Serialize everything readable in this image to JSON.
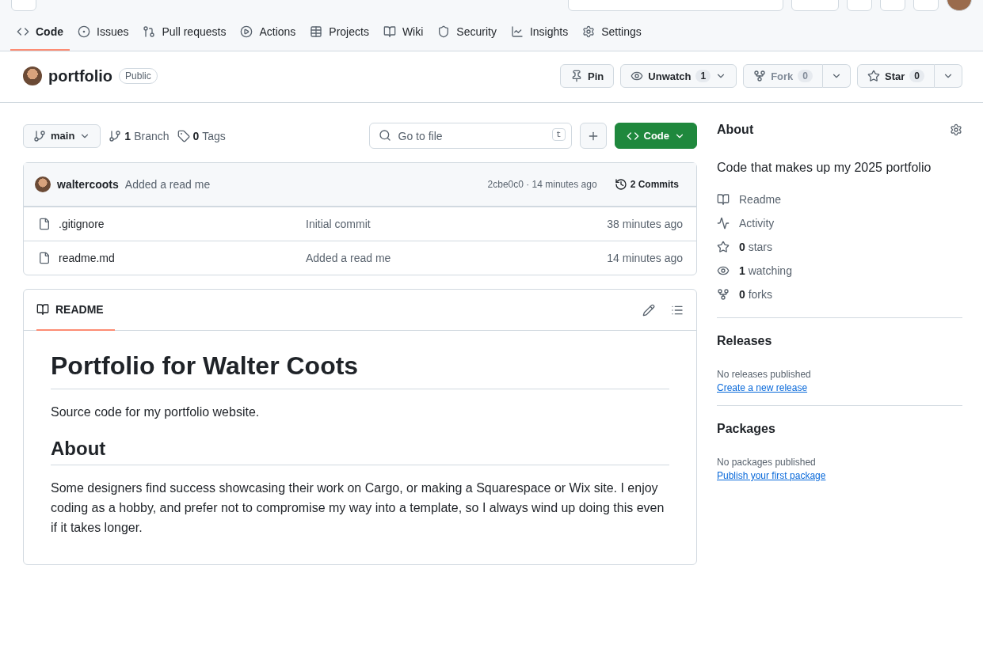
{
  "repo_nav": [
    {
      "label": "Code",
      "selected": true
    },
    {
      "label": "Issues",
      "selected": false
    },
    {
      "label": "Pull requests",
      "selected": false
    },
    {
      "label": "Actions",
      "selected": false
    },
    {
      "label": "Projects",
      "selected": false
    },
    {
      "label": "Wiki",
      "selected": false
    },
    {
      "label": "Security",
      "selected": false
    },
    {
      "label": "Insights",
      "selected": false
    },
    {
      "label": "Settings",
      "selected": false
    }
  ],
  "repo": {
    "name": "portfolio",
    "visibility": "Public"
  },
  "repo_actions": {
    "pin": "Pin",
    "watch": {
      "label": "Unwatch",
      "count": "1"
    },
    "fork": {
      "label": "Fork",
      "count": "0",
      "disabled": true
    },
    "star": {
      "label": "Star",
      "count": "0"
    }
  },
  "branch": {
    "name": "main",
    "branches": "1",
    "branches_label": "Branch",
    "tags": "0",
    "tags_label": "Tags"
  },
  "go_to_file": {
    "placeholder": "Go to file",
    "shortcut": "t"
  },
  "code_button": "Code",
  "latest_commit": {
    "author": "waltercoots",
    "message": "Added a read me",
    "hash_time": "2cbe0c0 · 14 minutes ago",
    "commits": "2 Commits"
  },
  "files": [
    {
      "name": ".gitignore",
      "commit": "Initial commit",
      "time": "38 minutes ago"
    },
    {
      "name": "readme.md",
      "commit": "Added a read me",
      "time": "14 minutes ago"
    }
  ],
  "readme": {
    "tab": "README",
    "title": "Portfolio for Walter Coots",
    "blocks": [
      {
        "kind": "p",
        "text": "Source code for my portfolio website."
      },
      {
        "kind": "h2",
        "text": "About"
      },
      {
        "kind": "p",
        "text": "Some designers find success showcasing their work on Cargo, or making a Squarespace or Wix site. I enjoy coding as a hobby, and prefer not to compromise my way into a template, so I always wind up doing this even if it takes longer."
      }
    ]
  },
  "about": {
    "title": "About",
    "description": "Code that makes up my 2025 portfolio",
    "items": [
      {
        "label": "Readme"
      },
      {
        "label": "Activity"
      },
      {
        "count": "0",
        "label": "stars"
      },
      {
        "count": "1",
        "label": "watching"
      },
      {
        "count": "0",
        "label": "forks"
      }
    ]
  },
  "releases": {
    "title": "Releases",
    "note": "No releases published",
    "link": "Create a new release"
  },
  "packages": {
    "title": "Packages",
    "note": "No packages published",
    "link": "Publish your first package"
  }
}
